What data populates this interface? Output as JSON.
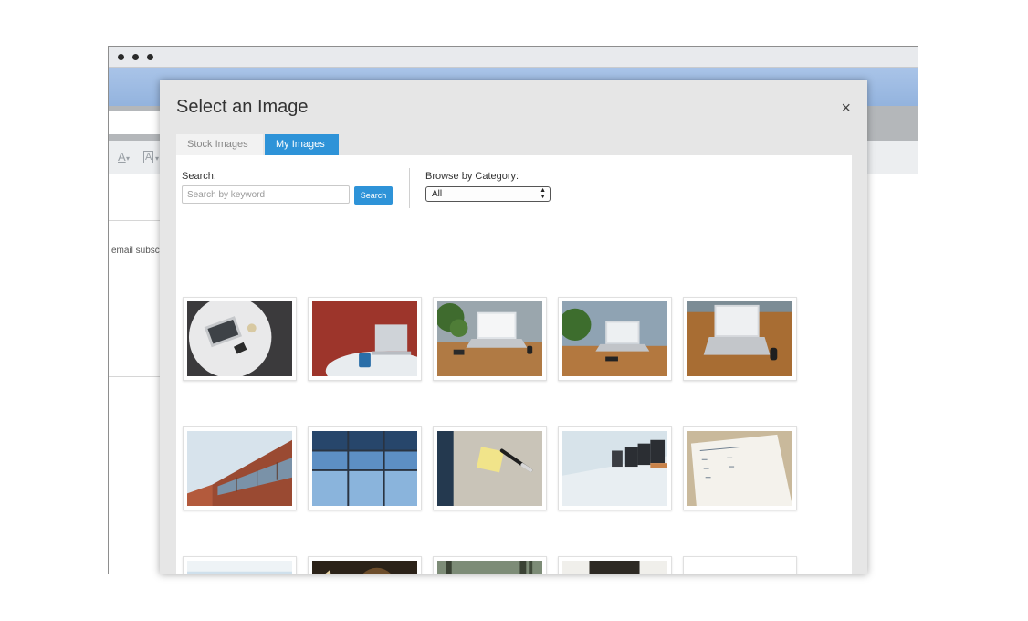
{
  "background_app": {
    "toolbar_icons": [
      "A",
      "A"
    ],
    "snippet_text": "email subsc"
  },
  "modal": {
    "title": "Select an Image",
    "close_symbol": "×",
    "tabs": [
      {
        "label": "Stock Images",
        "active": false
      },
      {
        "label": "My Images",
        "active": true
      }
    ],
    "search": {
      "label": "Search:",
      "placeholder": "Search by keyword",
      "value": "",
      "button_label": "Search"
    },
    "category": {
      "label": "Browse by Category:",
      "selected": "All"
    },
    "accent_color": "#2e93d8",
    "images": [
      {
        "subject": "laptop-on-round-table-top-view"
      },
      {
        "subject": "laptop-with-coffee-mug-red-wall"
      },
      {
        "subject": "laptop-on-desk-with-plant"
      },
      {
        "subject": "laptop-on-desk-with-plant-2"
      },
      {
        "subject": "laptop-on-wooden-desk"
      },
      {
        "subject": "red-brick-office-building"
      },
      {
        "subject": "glass-building-facade"
      },
      {
        "subject": "sticky-note-and-marker"
      },
      {
        "subject": "conference-room-chairs"
      },
      {
        "subject": "notepad-agenda-list"
      },
      {
        "subject": "meeting-room-table"
      },
      {
        "subject": "woman-reading-by-lamp"
      },
      {
        "subject": "forest-road-cyclist"
      },
      {
        "subject": "dog-on-porch-steps"
      },
      {
        "subject": "pug-portrait"
      }
    ]
  }
}
